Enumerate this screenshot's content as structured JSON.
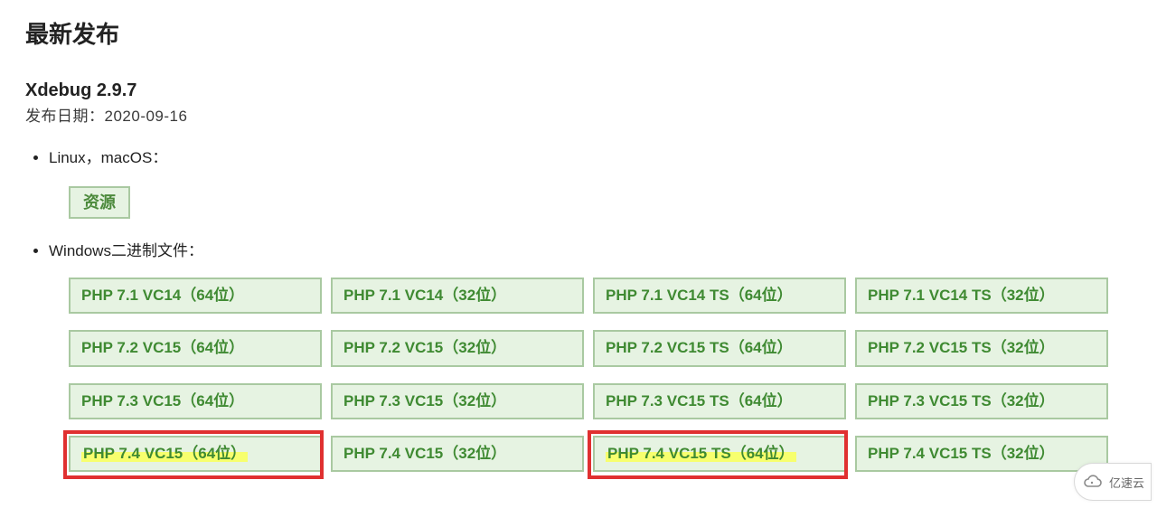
{
  "title": "最新发布",
  "product": "Xdebug 2.9.7",
  "release_date_line": "发布日期：2020-09-16",
  "sections": {
    "linux_macos_label": "Linux，macOS：",
    "source_button": "资源",
    "windows_label": "Windows二进制文件：",
    "downloads": [
      {
        "label": "PHP 7.1 VC14（64位）",
        "highlighted": false
      },
      {
        "label": "PHP 7.1 VC14（32位）",
        "highlighted": false
      },
      {
        "label": "PHP 7.1 VC14 TS（64位）",
        "highlighted": false
      },
      {
        "label": "PHP 7.1 VC14 TS（32位）",
        "highlighted": false
      },
      {
        "label": "PHP 7.2 VC15（64位）",
        "highlighted": false
      },
      {
        "label": "PHP 7.2 VC15（32位）",
        "highlighted": false
      },
      {
        "label": "PHP 7.2 VC15 TS（64位）",
        "highlighted": false
      },
      {
        "label": "PHP 7.2 VC15 TS（32位）",
        "highlighted": false
      },
      {
        "label": "PHP 7.3 VC15（64位）",
        "highlighted": false
      },
      {
        "label": "PHP 7.3 VC15（32位）",
        "highlighted": false
      },
      {
        "label": "PHP 7.3 VC15 TS（64位）",
        "highlighted": false
      },
      {
        "label": "PHP 7.3 VC15 TS（32位）",
        "highlighted": false
      },
      {
        "label": "PHP 7.4 VC15（64位）",
        "highlighted": true
      },
      {
        "label": "PHP 7.4 VC15（32位）",
        "highlighted": false
      },
      {
        "label": "PHP 7.4 VC15 TS（64位）",
        "highlighted": true
      },
      {
        "label": "PHP 7.4 VC15 TS（32位）",
        "highlighted": false
      }
    ]
  },
  "watermark": {
    "text": "亿速云"
  },
  "colors": {
    "button_bg": "#e6f3e2",
    "button_border": "#a9c9a1",
    "button_text": "#3f8a32",
    "highlight_frame": "#e03030",
    "highlight_fill": "#f7ff6e"
  }
}
